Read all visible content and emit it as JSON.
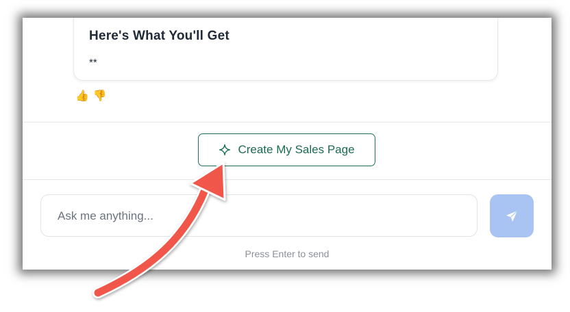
{
  "message": {
    "heading": "Here's What You'll Get",
    "body": "**"
  },
  "feedback": {
    "thumbs_up": "👍",
    "thumbs_down": "👎"
  },
  "cta": {
    "label": "Create My Sales Page"
  },
  "composer": {
    "placeholder": "Ask me anything...",
    "value": "",
    "hint": "Press Enter to send"
  },
  "colors": {
    "accent_green": "#1a6b50",
    "send_button": "#a9c4f2",
    "annotation_arrow": "#f0574a"
  }
}
